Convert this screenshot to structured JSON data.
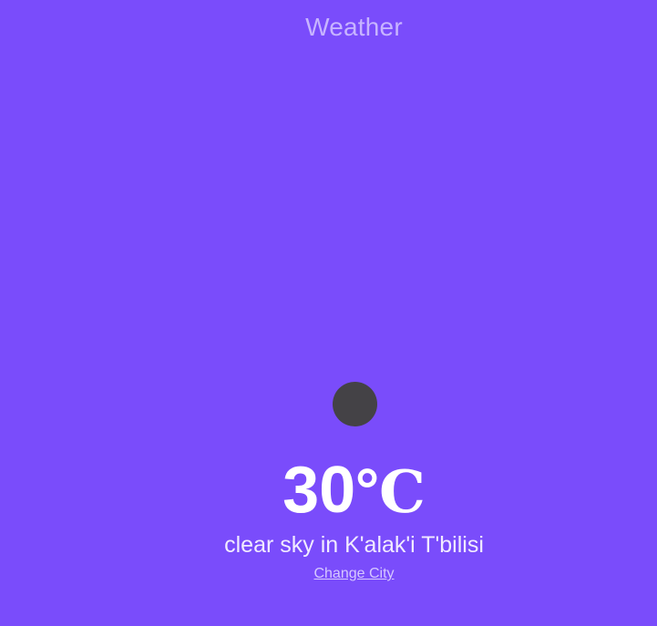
{
  "app": {
    "title": "Weather"
  },
  "weather": {
    "temperature_value": "30",
    "temperature_unit": "℃",
    "description": "clear sky in K'alak'i T'bilisi",
    "icon": "weather-condition-icon"
  },
  "actions": {
    "change_city_label": "Change City"
  },
  "colors": {
    "background": "#7a4cfb",
    "title_text": "#c7b4ff",
    "primary_text": "#ffffff",
    "icon_fill": "#444246",
    "link": "#d6c8ff"
  }
}
